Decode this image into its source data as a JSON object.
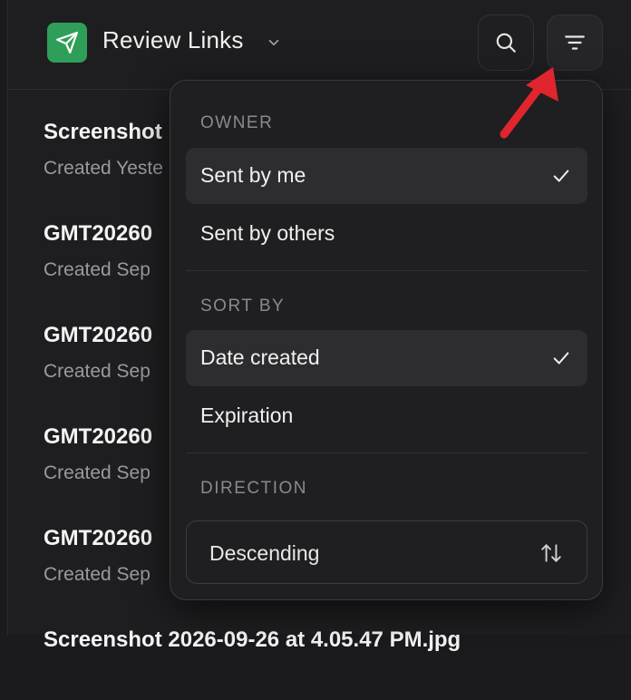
{
  "header": {
    "title": "Review Links",
    "app_icon": "send-icon",
    "search_icon": "search-icon",
    "filter_icon": "filter-icon"
  },
  "list": {
    "items": [
      {
        "title": "Screenshot",
        "subtitle": "Created Yeste"
      },
      {
        "title": "GMT20260",
        "subtitle": "Created Sep"
      },
      {
        "title": "GMT20260",
        "subtitle": "Created Sep"
      },
      {
        "title": "GMT20260",
        "subtitle": "Created Sep"
      },
      {
        "title": "GMT20260",
        "subtitle": "Created Sep"
      },
      {
        "title": "Screenshot 2026-09-26 at 4.05.47 PM.jpg",
        "subtitle": ""
      }
    ]
  },
  "dropdown": {
    "owner": {
      "label": "OWNER",
      "options": [
        {
          "label": "Sent by me",
          "selected": true
        },
        {
          "label": "Sent by others",
          "selected": false
        }
      ]
    },
    "sort_by": {
      "label": "SORT BY",
      "options": [
        {
          "label": "Date created",
          "selected": true
        },
        {
          "label": "Expiration",
          "selected": false
        }
      ]
    },
    "direction": {
      "label": "DIRECTION",
      "value": "Descending",
      "icon": "sort-arrows-icon"
    }
  },
  "colors": {
    "accent_green": "#2f9e58",
    "annotation_red": "#e0252e",
    "background": "#1e1e20"
  }
}
